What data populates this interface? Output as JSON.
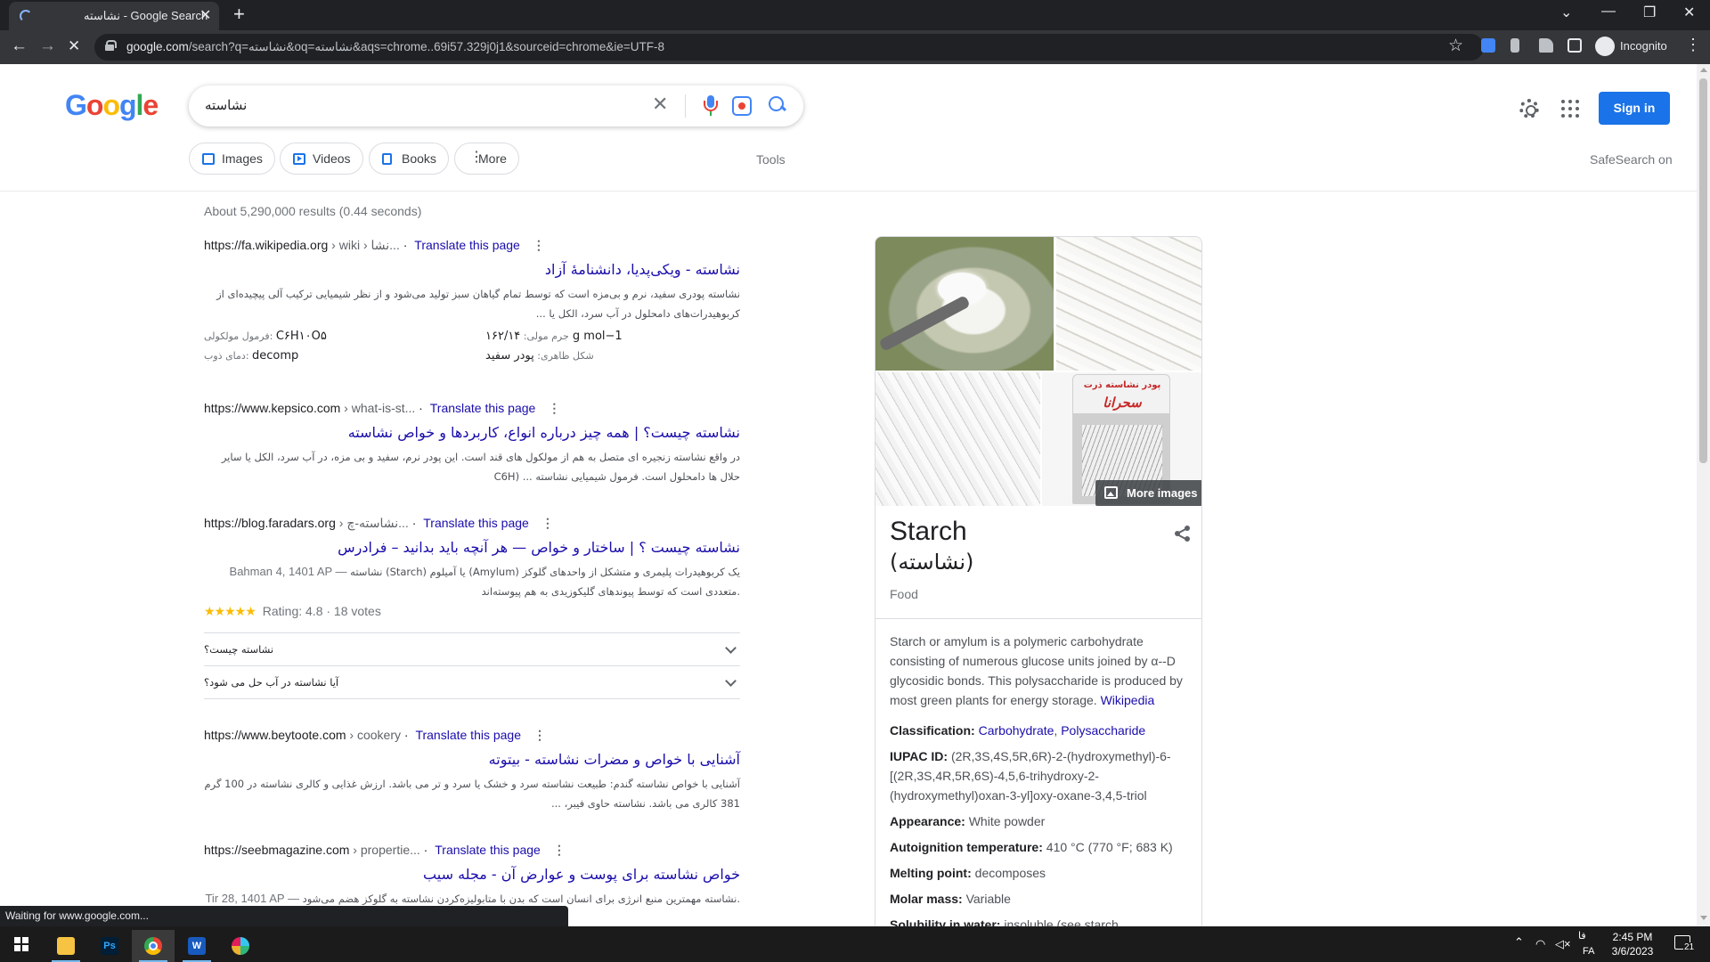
{
  "browser": {
    "tab_title": "نشاسته - Google Search",
    "url_domain": "google.com",
    "url_rest": "/search?q=نشاسته&oq=نشاسته&aqs=chrome..69i57.329j0j1&sourceid=chrome&ie=UTF-8",
    "incognito_label": "Incognito",
    "status_text": "Waiting for www.google.com..."
  },
  "google": {
    "logo_letters": [
      "G",
      "o",
      "o",
      "g",
      "l",
      "e"
    ],
    "query": "نشاسته",
    "signin_label": "Sign in",
    "chips": [
      "Images",
      "Videos",
      "Books",
      "More"
    ],
    "tools_label": "Tools",
    "safesearch_label": "SafeSearch on",
    "stats": "About 5,290,000 results (0.44 seconds)"
  },
  "results": [
    {
      "site": "https://fa.wikipedia.org",
      "path": " › wiki › نشا...",
      "translate": "Translate this page",
      "title": "نشاسته - ویکی‌پدیا، دانشنامهٔ آزاد",
      "snippet": "نشاسته پودری سفید، نرم و بی‌مزه است که توسط تمام گیاهان سبز تولید می‌شود و از نظر شیمیایی ترکیب آلی پیچیده‌ای از کربوهیدرات‌های دامحلول در آب سرد، الکل یا ...",
      "facts": [
        {
          "label": "فرمول مولکولی: ",
          "value": "C۶H۱۰O۵"
        },
        {
          "label": "جرم مولی: ",
          "value": "۱۶۲/۱۴ g mol−1"
        },
        {
          "label": "دمای ذوب: ",
          "value": "decomp"
        },
        {
          "label": "شکل ظاهری: ",
          "value": "پودر سفید"
        }
      ]
    },
    {
      "site": "https://www.kepsico.com",
      "path": " › what-is-st...",
      "translate": "Translate this page",
      "title": "نشاسته چیست؟ | همه چیز درباره انواع، کاربردها و خواص نشاسته",
      "snippet": "در واقع نشاسته زنجیره ای متصل به هم از مولکول های قند است. این پودر نرم، سفید و بی مزه، در آب سرد، الکل یا سایر حلال ها دامحلول است. فرمول شیمیایی نشاسته ... (C6H"
    },
    {
      "site": "https://blog.faradars.org",
      "path": " › نشاسته-چ...",
      "translate": "Translate this page",
      "title": "نشاسته چیست ؟ | ساختار و خواص — هر آنچه باید بدانید – فرادرس",
      "date": "Bahman 4, 1401 AP — ",
      "snippet": "نشاسته (Starch) یا آمیلوم (Amylum) یک کربوهیدرات پلیمری و متشکل از واحدهای گلوکز متعددی است که توسط پیوندهای گلیکوزیدی به هم پیوسته‌اند.",
      "stars": "★★★★★",
      "rating": "Rating: 4.8 · 18 votes"
    },
    {
      "site": "https://www.beytoote.com",
      "path": " › cookery",
      "translate": "Translate this page",
      "title": "آشنایی با خواص و مضرات نشاسته - بیتوته",
      "snippet": "آشنایی با خواص نشاسته گندم: طبیعت نشاسته سرد و خشک یا سرد و تر می باشد. ارزش غذایی و کالری نشاسته در 100 گرم 381 کالری می باشد. نشاسته حاوی فیبر، ..."
    },
    {
      "site": "https://seebmagazine.com",
      "path": " › propertie...",
      "translate": "Translate this page",
      "title": "خواص نشاسته برای پوست و عوارض آن - مجله سیب",
      "date": "Tir 28, 1401 AP — ",
      "snippet": "نشاسته مهمترین منبع انرژی برای انسان است که بدن با متابولیزه‌کردن نشاسته به گلوکز هضم می‌شود."
    }
  ],
  "paa": [
    "نشاسته چیست؟",
    "آیا نشاسته در آب حل می شود؟"
  ],
  "knowledge_panel": {
    "bag_label_top": "پودر نشاسته ذرت",
    "bag_brand": "سحرانا",
    "more_images": "More images",
    "title": "Starch",
    "subtitle": "(نشاسته)",
    "type": "Food",
    "description": "Starch or amylum is a polymeric carbohydrate consisting of numerous glucose units joined by α-‐D glycosidic bonds. This polysaccharide is produced by most green plants for energy storage. ",
    "description_source": "Wikipedia",
    "facts": [
      {
        "label": "Classification: ",
        "value": "",
        "links": [
          "Carbohydrate",
          "Polysaccharide"
        ]
      },
      {
        "label": "IUPAC ID: ",
        "value": "(2R,3S,4S,5R,6R)-2-(hydroxymethyl)-6-[(2R,3S,4R,5R,6S)-4,5,6-trihydroxy-2-(hydroxymethyl)oxan-3-yl]oxy-oxane-3,4,5-triol"
      },
      {
        "label": "Appearance: ",
        "value": "White powder"
      },
      {
        "label": "Autoignition temperature: ",
        "value": "410 °C (770 °F; 683 K)"
      },
      {
        "label": "Melting point: ",
        "value": "decomposes"
      },
      {
        "label": "Molar mass: ",
        "value": "Variable"
      },
      {
        "label": "Solubility in water: ",
        "value": "insoluble (see starch"
      }
    ]
  },
  "taskbar": {
    "apps": [
      {
        "name": "file-explorer",
        "label": ""
      },
      {
        "name": "photoshop",
        "label": "Ps"
      },
      {
        "name": "chrome",
        "label": ""
      },
      {
        "name": "word",
        "label": "W"
      },
      {
        "name": "slack",
        "label": ""
      }
    ],
    "language": "فا",
    "language2": "FA",
    "time": "2:45 PM",
    "date": "3/6/2023",
    "notifications": "21"
  },
  "colors": {
    "link": "#1a0dab",
    "accent": "#1a73e8",
    "chrome_dark": "#202124",
    "star": "#fbbc04"
  }
}
